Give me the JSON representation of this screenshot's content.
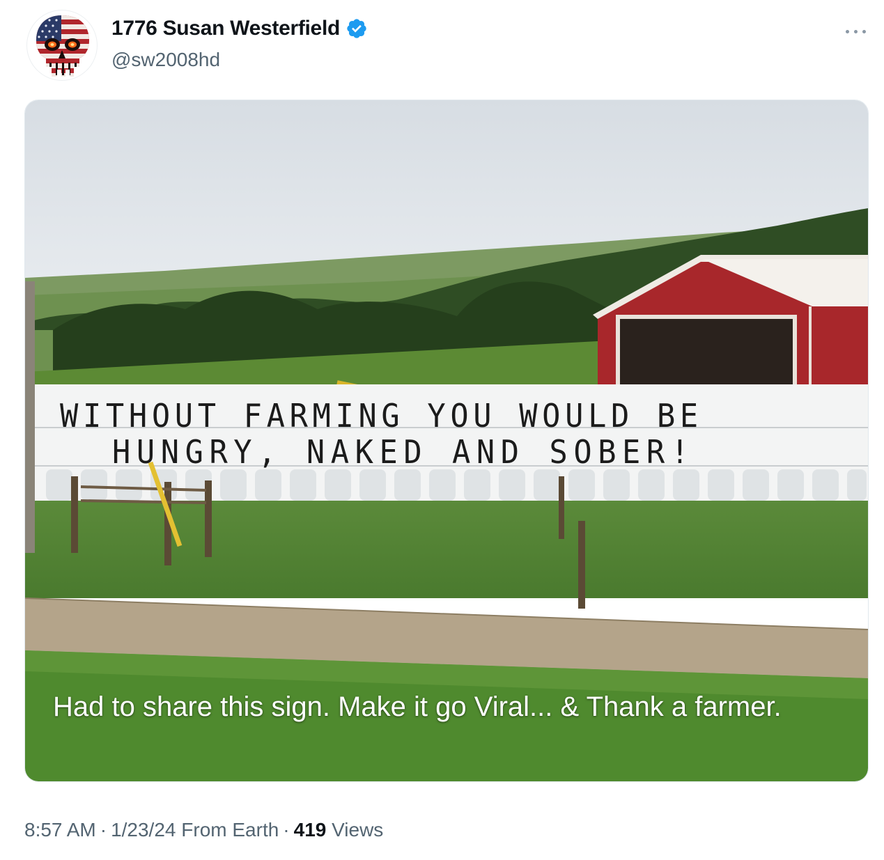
{
  "author": {
    "display_name": "1776 Susan Westerfield",
    "handle": "@sw2008hd",
    "verified": true,
    "avatar_icon": "punisher-skull-flag-icon"
  },
  "post": {
    "image": {
      "sign_line_1": "WITHOUT FARMING YOU WOULD BE",
      "sign_line_2": "HUNGRY, NAKED AND SOBER!",
      "caption": "Had to share this sign. Make it go Viral... & Thank a farmer."
    },
    "time": "8:57 AM",
    "date": "1/23/24",
    "source": "From Earth",
    "views_count": "419",
    "views_label": "Views",
    "separator": "·"
  },
  "colors": {
    "verified_blue": "#1d9bf0",
    "muted_text": "#536471",
    "barn_red": "#a8272b"
  },
  "icons": {
    "more": "more-options-icon",
    "verified": "verified-badge-icon"
  }
}
